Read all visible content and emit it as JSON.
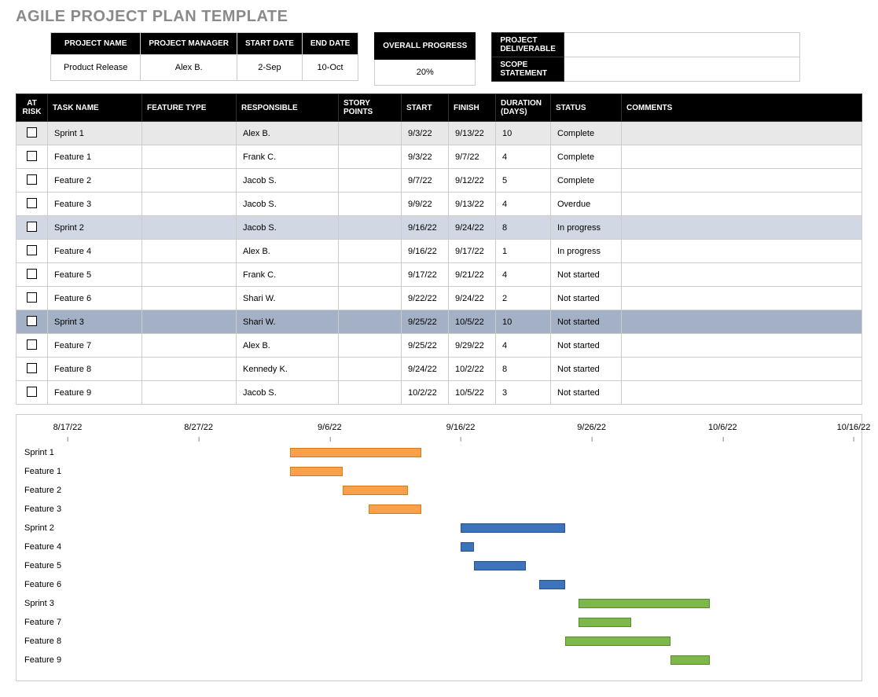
{
  "title": "AGILE PROJECT PLAN TEMPLATE",
  "info_headers": {
    "project_name": "PROJECT NAME",
    "project_manager": "PROJECT MANAGER",
    "start_date": "START DATE",
    "end_date": "END DATE"
  },
  "info_values": {
    "project_name": "Product Release",
    "project_manager": "Alex B.",
    "start_date": "2-Sep",
    "end_date": "10-Oct"
  },
  "overall_progress_label": "OVERALL PROGRESS",
  "overall_progress_value": "20%",
  "deliverable_label": "PROJECT DELIVERABLE",
  "scope_label": "SCOPE STATEMENT",
  "task_headers": {
    "at_risk": "AT RISK",
    "task_name": "TASK NAME",
    "feature_type": "FEATURE TYPE",
    "responsible": "RESPONSIBLE",
    "story_points": "STORY POINTS",
    "start": "START",
    "finish": "FINISH",
    "duration": "DURATION (DAYS)",
    "status": "STATUS",
    "comments": "COMMENTS"
  },
  "tasks": [
    {
      "name": "Sprint 1",
      "feature": "",
      "resp": "Alex B.",
      "story": "",
      "start": "9/3/22",
      "finish": "9/13/22",
      "dur": "10",
      "status": "Complete",
      "hl": "light"
    },
    {
      "name": "Feature 1",
      "feature": "",
      "resp": "Frank C.",
      "story": "",
      "start": "9/3/22",
      "finish": "9/7/22",
      "dur": "4",
      "status": "Complete",
      "hl": ""
    },
    {
      "name": "Feature 2",
      "feature": "",
      "resp": "Jacob S.",
      "story": "",
      "start": "9/7/22",
      "finish": "9/12/22",
      "dur": "5",
      "status": "Complete",
      "hl": ""
    },
    {
      "name": "Feature 3",
      "feature": "",
      "resp": "Jacob S.",
      "story": "",
      "start": "9/9/22",
      "finish": "9/13/22",
      "dur": "4",
      "status": "Overdue",
      "hl": ""
    },
    {
      "name": "Sprint 2",
      "feature": "",
      "resp": "Jacob S.",
      "story": "",
      "start": "9/16/22",
      "finish": "9/24/22",
      "dur": "8",
      "status": "In progress",
      "hl": "blue"
    },
    {
      "name": "Feature 4",
      "feature": "",
      "resp": "Alex B.",
      "story": "",
      "start": "9/16/22",
      "finish": "9/17/22",
      "dur": "1",
      "status": "In progress",
      "hl": ""
    },
    {
      "name": "Feature 5",
      "feature": "",
      "resp": "Frank C.",
      "story": "",
      "start": "9/17/22",
      "finish": "9/21/22",
      "dur": "4",
      "status": "Not started",
      "hl": ""
    },
    {
      "name": "Feature 6",
      "feature": "",
      "resp": "Shari W.",
      "story": "",
      "start": "9/22/22",
      "finish": "9/24/22",
      "dur": "2",
      "status": "Not started",
      "hl": ""
    },
    {
      "name": "Sprint 3",
      "feature": "",
      "resp": "Shari W.",
      "story": "",
      "start": "9/25/22",
      "finish": "10/5/22",
      "dur": "10",
      "status": "Not started",
      "hl": "med"
    },
    {
      "name": "Feature 7",
      "feature": "",
      "resp": "Alex B.",
      "story": "",
      "start": "9/25/22",
      "finish": "9/29/22",
      "dur": "4",
      "status": "Not started",
      "hl": ""
    },
    {
      "name": "Feature 8",
      "feature": "",
      "resp": "Kennedy K.",
      "story": "",
      "start": "9/24/22",
      "finish": "10/2/22",
      "dur": "8",
      "status": "Not started",
      "hl": ""
    },
    {
      "name": "Feature 9",
      "feature": "",
      "resp": "Jacob S.",
      "story": "",
      "start": "10/2/22",
      "finish": "10/5/22",
      "dur": "3",
      "status": "Not started",
      "hl": ""
    }
  ],
  "chart_data": {
    "type": "bar",
    "title": "",
    "x_axis_ticks": [
      "8/17/22",
      "8/27/22",
      "9/6/22",
      "9/16/22",
      "9/26/22",
      "10/6/22",
      "10/16/22"
    ],
    "x_range_days": {
      "start": "8/17/22",
      "end": "10/16/22",
      "total_days": 60
    },
    "series": [
      {
        "name": "Sprint 1",
        "start_day": 17,
        "dur": 10,
        "color": "orange"
      },
      {
        "name": "Feature 1",
        "start_day": 17,
        "dur": 4,
        "color": "orange"
      },
      {
        "name": "Feature 2",
        "start_day": 21,
        "dur": 5,
        "color": "orange"
      },
      {
        "name": "Feature 3",
        "start_day": 23,
        "dur": 4,
        "color": "orange"
      },
      {
        "name": "Sprint 2",
        "start_day": 30,
        "dur": 8,
        "color": "blue"
      },
      {
        "name": "Feature 4",
        "start_day": 30,
        "dur": 1,
        "color": "blue"
      },
      {
        "name": "Feature 5",
        "start_day": 31,
        "dur": 4,
        "color": "blue"
      },
      {
        "name": "Feature 6",
        "start_day": 36,
        "dur": 2,
        "color": "blue"
      },
      {
        "name": "Sprint 3",
        "start_day": 39,
        "dur": 10,
        "color": "green"
      },
      {
        "name": "Feature 7",
        "start_day": 39,
        "dur": 4,
        "color": "green"
      },
      {
        "name": "Feature 8",
        "start_day": 38,
        "dur": 8,
        "color": "green"
      },
      {
        "name": "Feature 9",
        "start_day": 46,
        "dur": 3,
        "color": "green"
      }
    ]
  }
}
